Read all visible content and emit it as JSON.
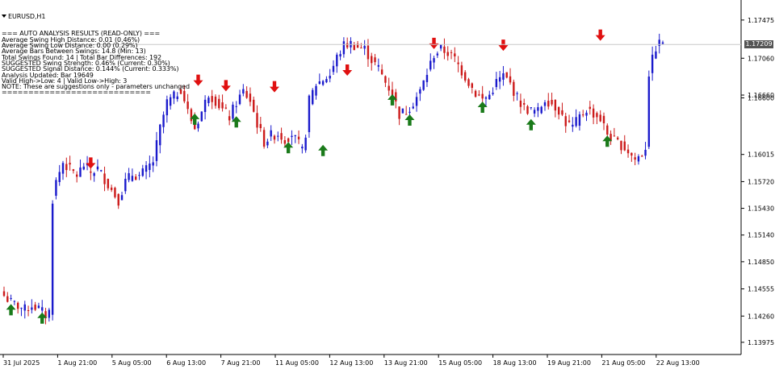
{
  "chart_window": {
    "symbol_label": "EURUSD,H1",
    "current_price": 1.17209
  },
  "overlay_lines": [
    "=== AUTO ANALYSIS RESULTS (READ-ONLY) ===",
    "Average Swing High Distance: 0.01 (0.46%)",
    "Average Swing Low Distance: 0.00 (0.29%)",
    "Average Bars Between Swings: 14.8 (Min: 13)",
    "Total Swings Found: 14 | Total Bar Differences: 192",
    "SUGGESTED Swing Strength: 0.46% (Current: 0.30%)",
    "SUGGESTED Signal Distance: 0.144% (Current: 0.333%)",
    "Analysis Updated: Bar 19649",
    "Valid High->Low: 4 | Valid Low->High: 3",
    "NOTE: These are suggestions only - parameters unchanged",
    "============================"
  ],
  "colors": {
    "bull": "#1a1acc",
    "bear": "#cc1a1a",
    "up_arrow": "#1a7a1a",
    "down_arrow": "#e01010",
    "grid": "#c8c8c8",
    "price_tag": "#555555"
  },
  "chart_data": {
    "type": "candlestick",
    "title": "EURUSD,H1",
    "y_ticks": [
      1.17475,
      1.1706,
      1.1666,
      1.1663,
      1.16015,
      1.1572,
      1.1543,
      1.1514,
      1.1485,
      1.14555,
      1.1426,
      1.13975
    ],
    "y_tick_labels": [
      "1.17475",
      "1.17060",
      "1.16660",
      "1.16600",
      "1.16015",
      "1.15720",
      "1.15430",
      "1.15140",
      "1.14850",
      "1.14555",
      "1.14260",
      "1.13975"
    ],
    "x_tick_labels": [
      "31 Jul 2025",
      "1 Aug 21:00",
      "5 Aug 05:00",
      "6 Aug 13:00",
      "7 Aug 21:00",
      "11 Aug 05:00",
      "12 Aug 13:00",
      "13 Aug 21:00",
      "15 Aug 05:00",
      "18 Aug 13:00",
      "19 Aug 21:00",
      "21 Aug 05:00",
      "22 Aug 13:00"
    ],
    "ylim": [
      1.1386,
      1.1764
    ],
    "close_path": [
      [
        0,
        1.1448
      ],
      [
        2,
        1.1441
      ],
      [
        4,
        1.1437
      ],
      [
        6,
        1.1433
      ],
      [
        8,
        1.1438
      ],
      [
        10,
        1.1434
      ],
      [
        12,
        1.1427
      ],
      [
        13,
        1.1431
      ],
      [
        14,
        1.1553
      ],
      [
        15,
        1.1572
      ],
      [
        17,
        1.1593
      ],
      [
        19,
        1.1585
      ],
      [
        21,
        1.1579
      ],
      [
        23,
        1.159
      ],
      [
        25,
        1.1582
      ],
      [
        27,
        1.1586
      ],
      [
        29,
        1.1575
      ],
      [
        31,
        1.1563
      ],
      [
        33,
        1.1552
      ],
      [
        35,
        1.1572
      ],
      [
        37,
        1.158
      ],
      [
        39,
        1.1578
      ],
      [
        41,
        1.1585
      ],
      [
        43,
        1.1594
      ],
      [
        45,
        1.163
      ],
      [
        47,
        1.1658
      ],
      [
        49,
        1.1664
      ],
      [
        51,
        1.1673
      ],
      [
        53,
        1.1648
      ],
      [
        55,
        1.163
      ],
      [
        57,
        1.1648
      ],
      [
        59,
        1.1668
      ],
      [
        61,
        1.166
      ],
      [
        63,
        1.165
      ],
      [
        65,
        1.1642
      ],
      [
        67,
        1.1658
      ],
      [
        69,
        1.167
      ],
      [
        71,
        1.166
      ],
      [
        73,
        1.1635
      ],
      [
        75,
        1.1615
      ],
      [
        77,
        1.1622
      ],
      [
        79,
        1.1624
      ],
      [
        81,
        1.1618
      ],
      [
        83,
        1.1624
      ],
      [
        85,
        1.1612
      ],
      [
        86,
        1.1605
      ],
      [
        87,
        1.1625
      ],
      [
        88,
        1.166
      ],
      [
        90,
        1.1678
      ],
      [
        92,
        1.1683
      ],
      [
        94,
        1.1688
      ],
      [
        96,
        1.1707
      ],
      [
        98,
        1.172
      ],
      [
        100,
        1.1722
      ],
      [
        102,
        1.1718
      ],
      [
        104,
        1.1716
      ],
      [
        106,
        1.1704
      ],
      [
        108,
        1.1695
      ],
      [
        110,
        1.168
      ],
      [
        112,
        1.1668
      ],
      [
        114,
        1.1645
      ],
      [
        116,
        1.1649
      ],
      [
        118,
        1.1658
      ],
      [
        120,
        1.167
      ],
      [
        122,
        1.169
      ],
      [
        124,
        1.171
      ],
      [
        126,
        1.1716
      ],
      [
        128,
        1.1712
      ],
      [
        130,
        1.1705
      ],
      [
        132,
        1.1692
      ],
      [
        134,
        1.168
      ],
      [
        136,
        1.1668
      ],
      [
        138,
        1.1661
      ],
      [
        140,
        1.1666
      ],
      [
        142,
        1.168
      ],
      [
        144,
        1.1687
      ],
      [
        146,
        1.1678
      ],
      [
        148,
        1.1663
      ],
      [
        150,
        1.1652
      ],
      [
        152,
        1.1649
      ],
      [
        154,
        1.1648
      ],
      [
        156,
        1.1662
      ],
      [
        158,
        1.1657
      ],
      [
        160,
        1.165
      ],
      [
        162,
        1.1636
      ],
      [
        164,
        1.1631
      ],
      [
        166,
        1.1642
      ],
      [
        168,
        1.1651
      ],
      [
        170,
        1.1646
      ],
      [
        172,
        1.164
      ],
      [
        174,
        1.1624
      ],
      [
        176,
        1.1616
      ],
      [
        178,
        1.1612
      ],
      [
        180,
        1.1605
      ],
      [
        182,
        1.1596
      ],
      [
        184,
        1.1602
      ],
      [
        185,
        1.161
      ],
      [
        186,
        1.169
      ],
      [
        188,
        1.1718
      ],
      [
        190,
        1.1725
      ]
    ],
    "down_arrows": [
      [
        25,
        1.1593
      ],
      [
        56,
        1.1683
      ],
      [
        64,
        1.1677
      ],
      [
        78,
        1.1676
      ],
      [
        99,
        1.1694
      ],
      [
        124,
        1.1723
      ],
      [
        144,
        1.1721
      ],
      [
        172,
        1.1732
      ]
    ],
    "up_arrows": [
      [
        2,
        1.1432
      ],
      [
        11,
        1.1423
      ],
      [
        55,
        1.1639
      ],
      [
        67,
        1.1636
      ],
      [
        82,
        1.1608
      ],
      [
        92,
        1.1605
      ],
      [
        112,
        1.166
      ],
      [
        117,
        1.1638
      ],
      [
        138,
        1.1652
      ],
      [
        152,
        1.1633
      ],
      [
        174,
        1.1615
      ]
    ],
    "last_bar_index": 190
  }
}
